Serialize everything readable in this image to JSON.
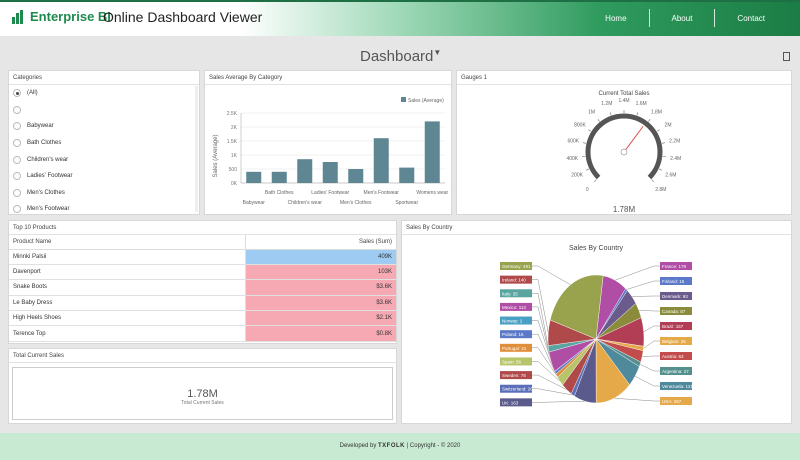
{
  "header": {
    "logo_text": "Enterprise BI",
    "app_title": "Online Dashboard Viewer",
    "nav": [
      "Home",
      "About",
      "Contact"
    ]
  },
  "dashboard_title": "Dashboard",
  "categories": {
    "title": "Categories",
    "items": [
      "(All)",
      "",
      "Babywear",
      "Bath Clothes",
      "Children's wear",
      "Ladies' Footwear",
      "Men's Clothes",
      "Men's Footwear"
    ],
    "selected": "(All)"
  },
  "sales_avg": {
    "title": "Sales Average By Category",
    "legend": "Sales (Average)",
    "ylabel": "Sales (Average)",
    "yticks": [
      "2.5K",
      "2K",
      "1.5K",
      "1K",
      "500",
      "0K"
    ],
    "xlabels_top": [
      "Bath Clothes",
      "Ladies' Footwear",
      "Men's Footwear",
      "Womens wear"
    ],
    "xlabels_bottom": [
      "Babywear",
      "Children's wear",
      "Men's Clothes",
      "Sportwear"
    ]
  },
  "gauge": {
    "title": "Gauges 1",
    "label": "Current Total Sales",
    "ticks": [
      "0",
      "200K",
      "400K",
      "600K",
      "800K",
      "1M",
      "1.2M",
      "1.4M",
      "1.6M",
      "1.8M",
      "2M",
      "2.2M",
      "2.4M",
      "2.6M",
      "2.8M"
    ],
    "value_text": "1.78M",
    "value": 1780000,
    "max": 2800000
  },
  "top_products": {
    "title": "Top 10 Products",
    "col_name": "Product Name",
    "col_sales": "Sales (Sum)",
    "rows": [
      {
        "name": "Minnki Palsii",
        "sales": "409K"
      },
      {
        "name": "Davenport",
        "sales": "103K"
      },
      {
        "name": "Snake Boots",
        "sales": "$3.6K"
      },
      {
        "name": "Le Baby Dress",
        "sales": "$3.6K"
      },
      {
        "name": "High Heels Shoes",
        "sales": "$2.1K"
      },
      {
        "name": "Terence Top",
        "sales": "$0.8K"
      }
    ]
  },
  "total_sales": {
    "title": "Total Current Sales",
    "value": "1.78M",
    "label": "Total Current Sales"
  },
  "sales_country": {
    "title": "Sales By Country",
    "chart_title": "Sales By Country"
  },
  "footer": {
    "prefix": "Developed by",
    "brand": "TXFOLK",
    "suffix": "| Copyright - © 2020"
  },
  "colors": {
    "brand_green": "#1e8a4e",
    "bar_color": "#5e8693",
    "row_highlight_blue": "#9dcbf2",
    "row_highlight_pink": "#f6a9b3"
  },
  "chart_data": [
    {
      "type": "bar",
      "title": "Sales Average By Category",
      "ylabel": "Sales (Average)",
      "categories": [
        "Babywear",
        "Bath Clothes",
        "Children's wear",
        "Ladies' Footwear",
        "Men's Clothes",
        "Men's Footwear",
        "Sportwear",
        "Womens wear"
      ],
      "series": [
        {
          "name": "Sales (Average)",
          "values": [
            400,
            400,
            850,
            750,
            500,
            1600,
            550,
            2200
          ]
        }
      ],
      "ylim": [
        0,
        2500
      ]
    },
    {
      "type": "pie",
      "title": "Sales By Country",
      "slices": [
        {
          "label": "France",
          "value": 178,
          "color": "#b04ea6"
        },
        {
          "label": "Finland",
          "value": 16,
          "color": "#5b79c8"
        },
        {
          "label": "Denmark",
          "value": 93,
          "color": "#6a5b8c"
        },
        {
          "label": "Canada",
          "value": 87,
          "color": "#8a8c3c"
        },
        {
          "label": "Brazil",
          "value": 157,
          "color": "#b23e55"
        },
        {
          "label": "Belgium",
          "value": 25,
          "color": "#e6a94a"
        },
        {
          "label": "Austria",
          "value": 63,
          "color": "#c24b4b"
        },
        {
          "label": "Argentina",
          "value": 27,
          "color": "#54908e"
        },
        {
          "label": "Venezuela",
          "value": 121,
          "color": "#4f8a9c"
        },
        {
          "label": "USA",
          "value": 267,
          "color": "#e6a94a"
        },
        {
          "label": "UK",
          "value": 163,
          "color": "#5a5b8c"
        },
        {
          "label": "Switzerland",
          "value": 26,
          "color": "#5b6fb8"
        },
        {
          "label": "Sweden",
          "value": 78,
          "color": "#b04a4a"
        },
        {
          "label": "Spain",
          "value": 56,
          "color": "#b7c46a"
        },
        {
          "label": "Portugal",
          "value": 21,
          "color": "#e08e3a"
        },
        {
          "label": "Poland",
          "value": 16,
          "color": "#5b79c8"
        },
        {
          "label": "Norway",
          "value": 1,
          "color": "#4aa0c4"
        },
        {
          "label": "Mexico",
          "value": 113,
          "color": "#b04ea6"
        },
        {
          "label": "Italy",
          "value": 35,
          "color": "#5aa5a0"
        },
        {
          "label": "Ireland",
          "value": 140,
          "color": "#b04a4a"
        },
        {
          "label": "Germany",
          "value": 491,
          "color": "#99a34e"
        }
      ]
    }
  ]
}
